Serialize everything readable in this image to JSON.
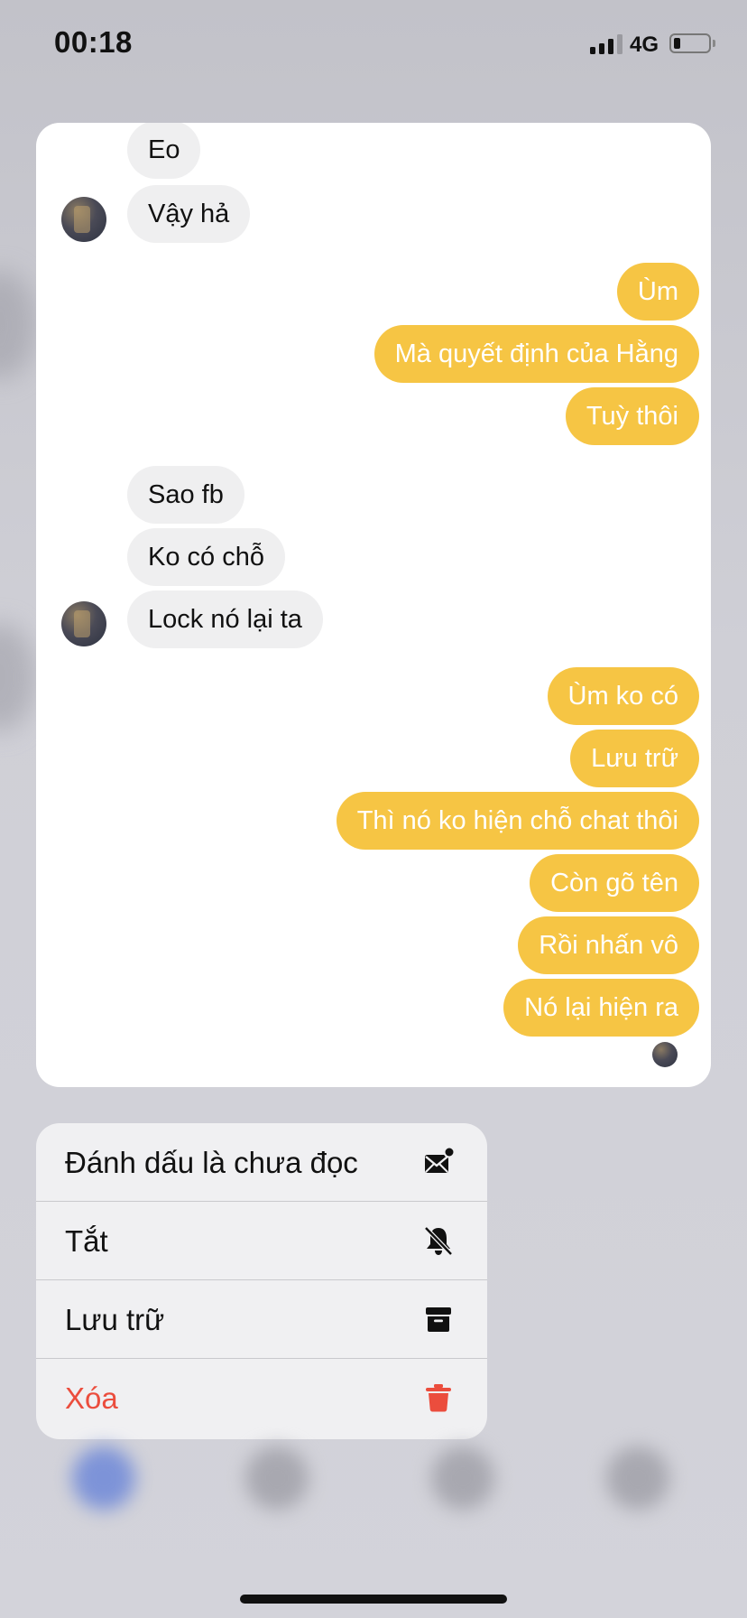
{
  "status_bar": {
    "time": "00:18",
    "network": "4G",
    "battery_level": 0.2
  },
  "conversation": {
    "groups": [
      {
        "sender": "other",
        "messages": [
          "Eo",
          "Vậy hả"
        ]
      },
      {
        "sender": "me",
        "messages": [
          "Ùm",
          "Mà quyết định của Hằng",
          "Tuỳ thôi"
        ]
      },
      {
        "sender": "other",
        "messages": [
          "Sao fb",
          "Ko có chỗ",
          "Lock nó lại ta"
        ]
      },
      {
        "sender": "me",
        "messages": [
          "Ùm ko có",
          "Lưu trữ",
          "Thì nó ko hiện chỗ chat thôi",
          "Còn gõ tên",
          "Rồi nhấn vô",
          "Nó lại hiện ra"
        ]
      }
    ],
    "avatar_icon": "contact-avatar",
    "seen_icon": "seen-avatar"
  },
  "context_menu": {
    "items": [
      {
        "label": "Đánh dấu là chưa đọc",
        "icon": "mark-unread-icon",
        "danger": false
      },
      {
        "label": "Tắt",
        "icon": "bell-slash-icon",
        "danger": false
      },
      {
        "label": "Lưu trữ",
        "icon": "archive-icon",
        "danger": false
      },
      {
        "label": "Xóa",
        "icon": "trash-icon",
        "danger": true
      }
    ]
  },
  "colors": {
    "outgoing_bubble": "#f6c544",
    "incoming_bubble": "#efeff0",
    "danger": "#eb4d3d"
  }
}
